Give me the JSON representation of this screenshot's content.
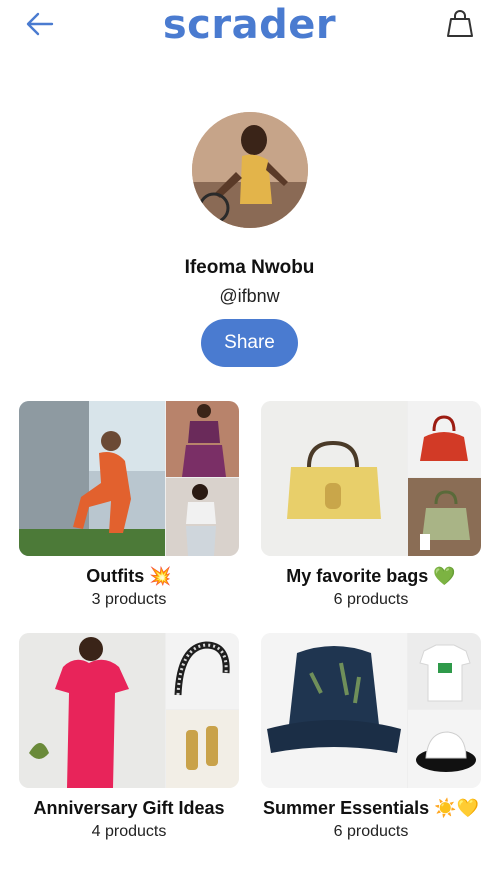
{
  "header": {
    "brand": "scrader",
    "back_icon": "arrow-left-icon",
    "bag_icon": "shopping-bag-icon",
    "accent_color": "#4a7bd0"
  },
  "profile": {
    "name": "Ifeoma Nwobu",
    "handle": "@ifbnw",
    "share_label": "Share"
  },
  "collections": [
    {
      "title": "Outfits 💥",
      "count": "3 products"
    },
    {
      "title": "My favorite bags 💚",
      "count": "6 products"
    },
    {
      "title": "Anniversary Gift Ideas",
      "count": "4 products"
    },
    {
      "title": "Summer Essentials ☀️💛",
      "count": "6 products"
    }
  ]
}
